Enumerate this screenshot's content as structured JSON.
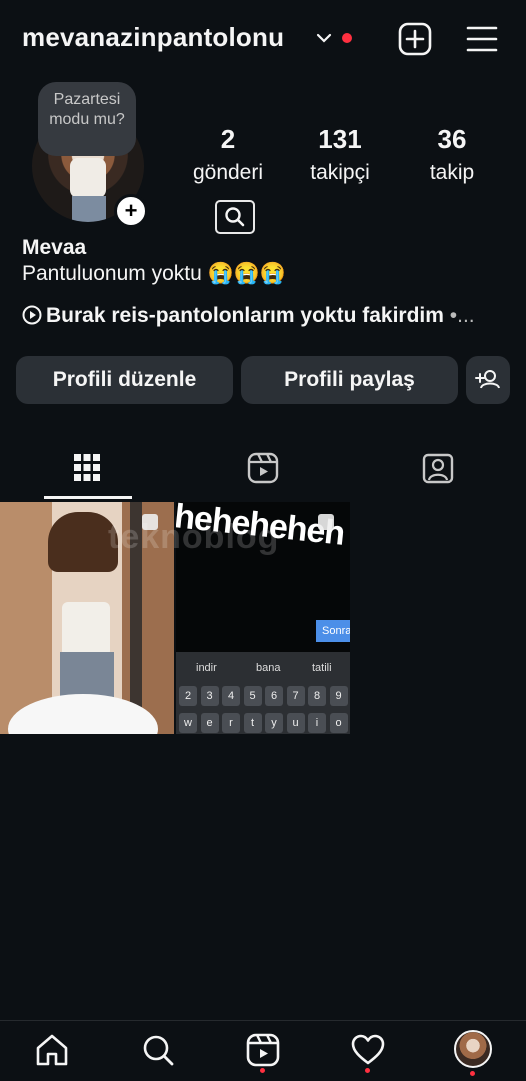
{
  "header": {
    "username": "mevanazinpantolonu",
    "icons": {
      "dropdown": "chevron-down-icon",
      "create": "plus-square-icon",
      "menu": "hamburger-menu-icon"
    },
    "accent_red": "#ff3040"
  },
  "profile": {
    "note": "Pazartesi modu mu?",
    "stats": {
      "posts": {
        "value": "2",
        "label": "gönderi"
      },
      "followers": {
        "value": "131",
        "label": "takipçi"
      },
      "following": {
        "value": "36",
        "label": "takip"
      }
    },
    "display_name": "Mevaa",
    "bio": "Pantuluonum yoktu 😭😭😭",
    "music": "Burak reis-pantolonlarım yoktu fakirdim",
    "music_more": "•..."
  },
  "actions": {
    "edit_profile": "Profili düzenle",
    "share_profile": "Profili paylaş"
  },
  "tabs": [
    {
      "name": "grid",
      "icon": "grid-icon",
      "active": true
    },
    {
      "name": "reels",
      "icon": "reels-icon",
      "active": false
    },
    {
      "name": "tagged",
      "icon": "tagged-icon",
      "active": false
    }
  ],
  "posts": [
    {
      "type": "photo",
      "description_icon": "mirror-selfie"
    },
    {
      "type": "screenshot",
      "overlay_text": "heheheheh",
      "button_text": "Sonra",
      "suggestions": [
        "indir",
        "bana",
        "tatili"
      ],
      "number_keys": [
        "2",
        "3",
        "4",
        "5",
        "6",
        "7",
        "8",
        "9"
      ],
      "letter_keys": [
        "w",
        "e",
        "r",
        "t",
        "y",
        "u",
        "i",
        "o"
      ]
    }
  ],
  "watermark": "teknoblog",
  "bottom_nav": [
    {
      "name": "home",
      "icon": "home-icon"
    },
    {
      "name": "search",
      "icon": "search-icon"
    },
    {
      "name": "reels",
      "icon": "reels-icon",
      "badge": true
    },
    {
      "name": "activity",
      "icon": "heart-icon",
      "badge": true
    },
    {
      "name": "profile",
      "icon": "avatar",
      "badge": true
    }
  ]
}
